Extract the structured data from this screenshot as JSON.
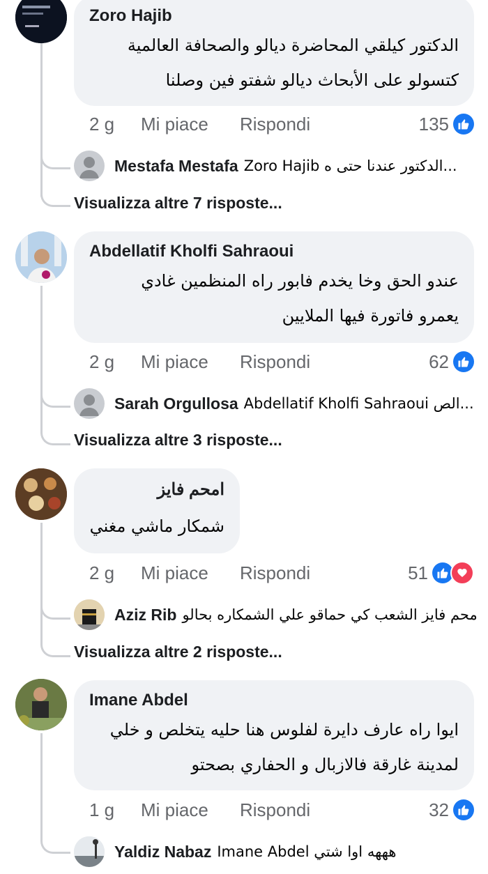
{
  "comments": [
    {
      "author": "Zoro Hajib",
      "lines": [
        "الدكتور كيلقي المحاضرة ديالو والصحافة العالمية",
        "كتسولو على الأبحاث  ديالو شفتو فين وصلنا"
      ],
      "time": "2 g",
      "like": "Mi piace",
      "reply": "Rispondi",
      "reactions": "135",
      "reply_author": "Mestafa Mestafa",
      "reply_text": "Zoro Hajib الدكتور عندنا حتى ه...",
      "more": "Visualizza altre 7 risposte..."
    },
    {
      "author": "Abdellatif Kholfi Sahraoui",
      "lines": [
        "عندو الحق  وخا يخدم فابور  راه المنظمين غادي",
        "يعمرو فاتورة فيها الملايين"
      ],
      "time": "2 g",
      "like": "Mi piace",
      "reply": "Rispondi",
      "reactions": "62",
      "reply_author": "Sarah Orgullosa",
      "reply_text": "Abdellatif Kholfi Sahraoui الص...",
      "more": "Visualizza altre 3 risposte..."
    },
    {
      "author": "امحم فايز",
      "lines": [
        "شمكار ماشي مغني"
      ],
      "time": "2 g",
      "like": "Mi piace",
      "reply": "Rispondi",
      "reactions": "51",
      "reply_author": "Aziz Rib",
      "reply_text": "امحم فايز الشعب كي حماقو علي الشمكاره بحالو",
      "more": "Visualizza altre 2 risposte..."
    },
    {
      "author": "Imane Abdel",
      "lines": [
        "ايوا راه عارف دايرة لفلوس هنا حليه يتخلص و خلي",
        "لمدينة غارقة فالازبال و الحفاري بصحتو"
      ],
      "time": "1 g",
      "like": "Mi piace",
      "reply": "Rispondi",
      "reactions": "32",
      "reply_author": "Yaldiz Nabaz",
      "reply_text": "Imane Abdel هههه اوا شتي"
    }
  ],
  "colors": {
    "like": "#1877f2",
    "love": "#f33e58",
    "bubble": "#f0f2f5",
    "meta": "#65676b"
  },
  "icons": [
    "like-icon",
    "love-icon",
    "default-avatar-icon"
  ]
}
